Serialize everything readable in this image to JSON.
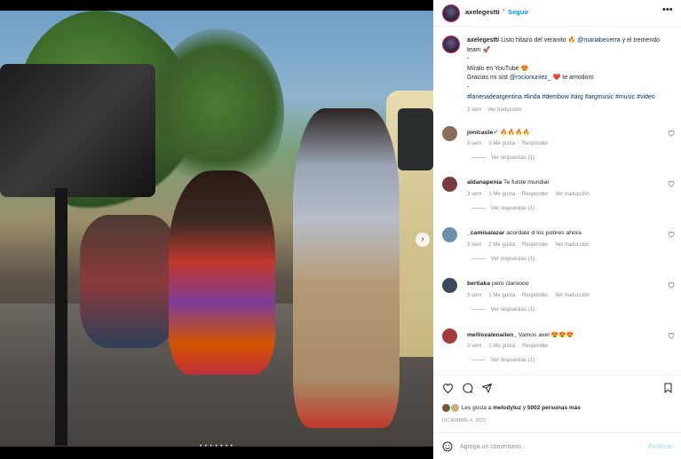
{
  "photo": {
    "next_icon": "chevron-right-icon",
    "carousel_dots": "• • • • • • •"
  },
  "header": {
    "username": "axelegestti",
    "separator": "•",
    "follow_label": "Seguir",
    "more_icon": "more-horizontal-icon",
    "more_label": "•••"
  },
  "caption": {
    "username": "axelegestti",
    "line1": " Listo hitazo del veranito 🔥 ",
    "mention1": "@mariabecerra",
    "line1_end": " y el tremendo team 🚀",
    "line2": "-",
    "line3": "Míralo en YouTube 😍",
    "line4_start": "Gracias mi sist ",
    "mention2": "@rocionuniez_",
    "line4_end": " ❤️ te amodoro",
    "line5": "-",
    "hashtags": "#lanenadeargentina #linda #dembow #arg #argmusic #music #video",
    "time": "3 sem",
    "see_translation": "Ver traducción"
  },
  "comments": [
    {
      "username": "jonicaste",
      "verified": "✔",
      "text": " 🔥🔥🔥🔥",
      "time": "3 sem",
      "likes": "3 Me gusta",
      "reply": "Responder",
      "translate": "",
      "view_replies": "Ver respuestas (1)",
      "avatar_color": "#8a6d5a"
    },
    {
      "username": "aldanapenia",
      "verified": "",
      "text": " Te fuiste mundial",
      "time": "3 sem",
      "likes": "1 Me gusta",
      "reply": "Responder",
      "translate": "Ver traducción",
      "view_replies": "Ver respuestas (1)",
      "avatar_color": "#7a3b3b"
    },
    {
      "username": "_camisalazar",
      "verified": "",
      "text": " acordate d los pobres ahora",
      "time": "3 sem",
      "likes": "2 Me gusta",
      "reply": "Responder",
      "translate": "Ver traducción",
      "view_replies": "Ver respuestas (1)",
      "avatar_color": "#6d8fa8"
    },
    {
      "username": "bertiaka",
      "verified": "",
      "text": " pero claroooo",
      "time": "3 sem",
      "likes": "1 Me gusta",
      "reply": "Responder",
      "translate": "Ver traducción",
      "view_replies": "Ver respuestas (1)",
      "avatar_color": "#3a4a5a"
    },
    {
      "username": "mellisvalenailen_",
      "verified": "",
      "text": " Vamos axel 😍😍😍",
      "time": "3 sem",
      "likes": "1 Me gusta",
      "reply": "Responder",
      "translate": "",
      "view_replies": "Ver respuestas (1)",
      "avatar_color": "#a33a3a"
    }
  ],
  "actions": {
    "like_icon": "heart-icon",
    "comment_icon": "comment-icon",
    "share_icon": "share-icon",
    "save_icon": "bookmark-icon",
    "likes_prefix": "Les gusta a ",
    "likes_user": "melodyluz",
    "likes_middle": " y ",
    "likes_count": "5002 personas más",
    "date": "DICIEMBRE 4, 2022"
  },
  "add_comment": {
    "emoji_icon": "smiley-icon",
    "placeholder": "Agrega un comentario...",
    "publish_label": "Publicar"
  },
  "colors": {
    "link": "#0095f6",
    "mention": "#00376b",
    "muted": "#8e8e8e",
    "publish_disabled": "#b2dffc"
  }
}
